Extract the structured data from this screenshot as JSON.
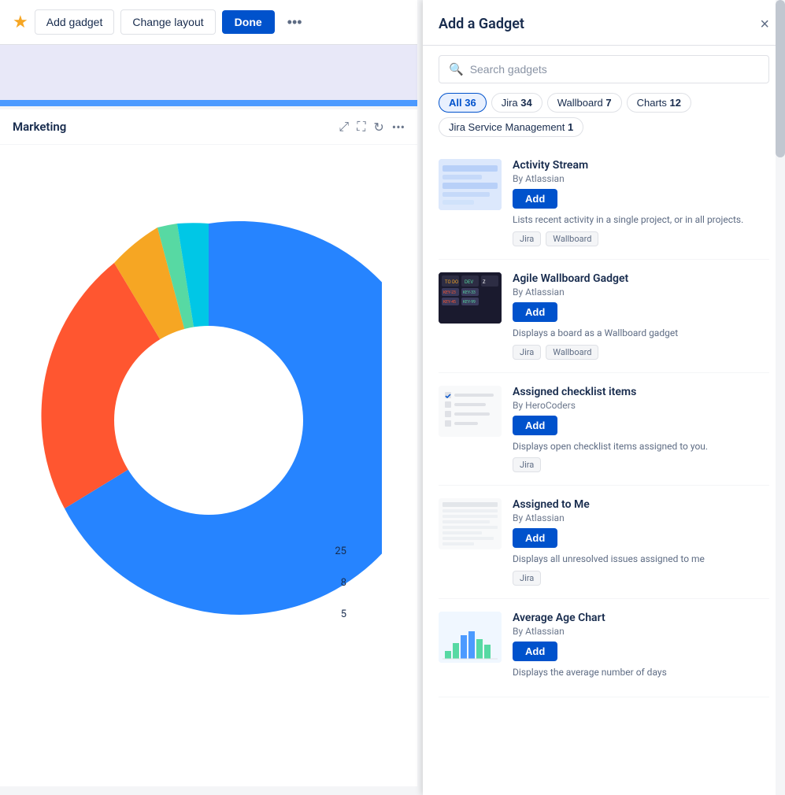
{
  "toolbar": {
    "star_icon": "★",
    "add_gadget_label": "Add gadget",
    "change_layout_label": "Change layout",
    "done_label": "Done",
    "more_icon": "•••"
  },
  "chart": {
    "title": "Marketing",
    "legend_values": [
      "25",
      "8",
      "5"
    ],
    "colors": {
      "blue": "#2684ff",
      "orange": "#f6a623",
      "green": "#57d9a3",
      "teal": "#00c7e6",
      "red": "#ff5630"
    }
  },
  "modal": {
    "title": "Add a Gadget",
    "close_label": "×",
    "search_placeholder": "Search gadgets",
    "filters": [
      {
        "label": "All",
        "count": "36",
        "active": true
      },
      {
        "label": "Jira",
        "count": "34",
        "active": false
      },
      {
        "label": "Wallboard",
        "count": "7",
        "active": false
      },
      {
        "label": "Charts",
        "count": "12",
        "active": false
      },
      {
        "label": "Jira Service Management",
        "count": "1",
        "active": false
      }
    ],
    "gadgets": [
      {
        "name": "Activity Stream",
        "author": "By Atlassian",
        "description": "Lists recent activity in a single project, or in all projects.",
        "tags": [
          "Jira",
          "Wallboard"
        ],
        "add_label": "Add",
        "thumb_type": "activity"
      },
      {
        "name": "Agile Wallboard Gadget",
        "author": "By Atlassian",
        "description": "Displays a board as a Wallboard gadget",
        "tags": [
          "Jira",
          "Wallboard"
        ],
        "add_label": "Add",
        "thumb_type": "wallboard"
      },
      {
        "name": "Assigned checklist items",
        "author": "By HeroCoders",
        "description": "Displays open checklist items assigned to you.",
        "tags": [
          "Jira"
        ],
        "add_label": "Add",
        "thumb_type": "checklist"
      },
      {
        "name": "Assigned to Me",
        "author": "By Atlassian",
        "description": "Displays all unresolved issues assigned to me",
        "tags": [
          "Jira"
        ],
        "add_label": "Add",
        "thumb_type": "assigned"
      },
      {
        "name": "Average Age Chart",
        "author": "By Atlassian",
        "description": "Displays the average number of days",
        "tags": [],
        "add_label": "Add",
        "thumb_type": "avg-age"
      }
    ]
  }
}
